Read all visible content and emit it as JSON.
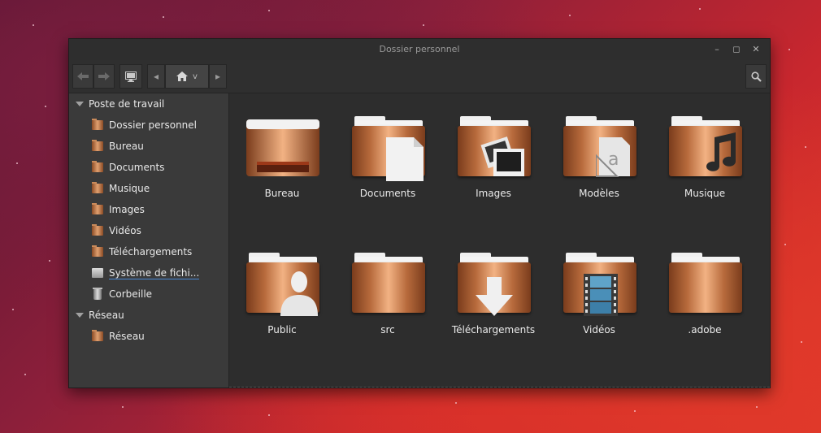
{
  "window": {
    "title": "Dossier personnel"
  },
  "window_controls": {
    "minimize": "–",
    "maximize": "◻",
    "close": "✕"
  },
  "toolbar": {
    "back_icon": "arrow-left-icon",
    "forward_icon": "arrow-right-icon",
    "computer_icon": "computer-icon",
    "path_prev": "◂",
    "home_icon": "home-icon",
    "path_dropdown": "v",
    "path_next": "▸",
    "search_icon": "search-icon"
  },
  "sidebar": {
    "sections": [
      {
        "title": "Poste de travail",
        "items": [
          {
            "label": "Dossier personnel",
            "icon": "home-folder-icon"
          },
          {
            "label": "Bureau",
            "icon": "desktop-folder-icon"
          },
          {
            "label": "Documents",
            "icon": "documents-folder-icon"
          },
          {
            "label": "Musique",
            "icon": "music-folder-icon"
          },
          {
            "label": "Images",
            "icon": "pictures-folder-icon"
          },
          {
            "label": "Vidéos",
            "icon": "videos-folder-icon"
          },
          {
            "label": "Téléchargements",
            "icon": "downloads-folder-icon"
          },
          {
            "label": "Système de fichi...",
            "icon": "filesystem-icon"
          },
          {
            "label": "Corbeille",
            "icon": "trash-icon"
          }
        ]
      },
      {
        "title": "Réseau",
        "items": [
          {
            "label": "Réseau",
            "icon": "network-folder-icon"
          }
        ]
      }
    ]
  },
  "files": [
    {
      "label": "Bureau",
      "icon": "desktop-folder-icon"
    },
    {
      "label": "Documents",
      "icon": "documents-folder-icon"
    },
    {
      "label": "Images",
      "icon": "pictures-folder-icon"
    },
    {
      "label": "Modèles",
      "icon": "templates-folder-icon"
    },
    {
      "label": "Musique",
      "icon": "music-folder-icon"
    },
    {
      "label": "Public",
      "icon": "public-folder-icon"
    },
    {
      "label": "src",
      "icon": "folder-icon"
    },
    {
      "label": "Téléchargements",
      "icon": "downloads-folder-icon"
    },
    {
      "label": "Vidéos",
      "icon": "videos-folder-icon"
    },
    {
      "label": ".adobe",
      "icon": "folder-icon"
    }
  ],
  "colors": {
    "accent": "#4a8ad8",
    "folder": "#d08a58",
    "background": "#2d2d2d"
  }
}
